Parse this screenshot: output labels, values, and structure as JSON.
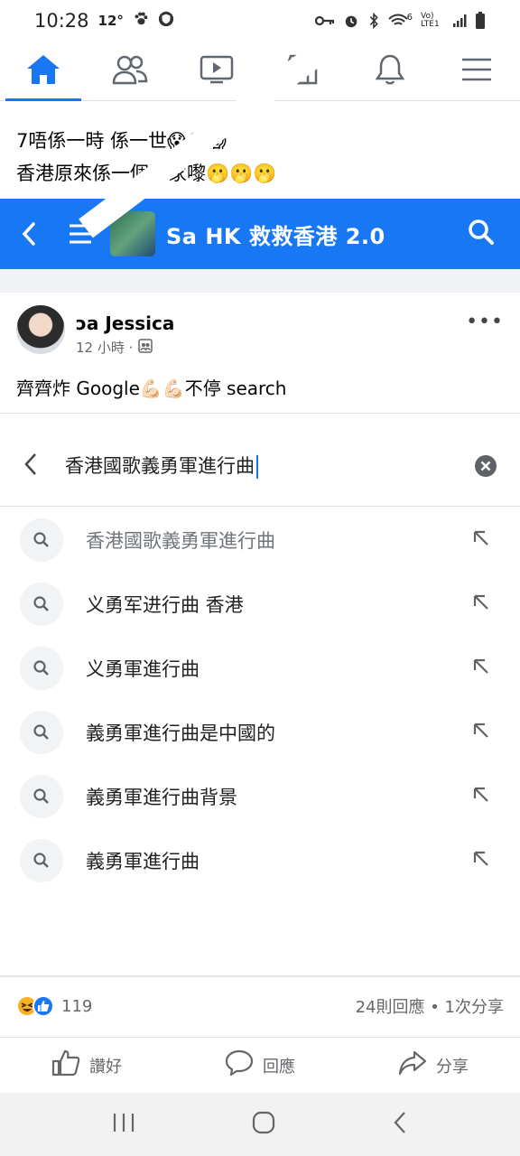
{
  "status_bar": {
    "time": "10:28",
    "temperature": "12°",
    "network_label": "Vo) LTE1",
    "signal_badge": "6",
    "icons": [
      "paw-icon",
      "shield-icon",
      "key-icon",
      "alarm-icon",
      "bluetooth-icon",
      "wifi-icon",
      "signal-icon",
      "battery-icon"
    ]
  },
  "top_nav": {
    "tabs": [
      {
        "name": "home",
        "icon": "home-icon",
        "active": true
      },
      {
        "name": "friends",
        "icon": "friends-icon",
        "active": false
      },
      {
        "name": "watch",
        "icon": "video-icon",
        "active": false
      },
      {
        "name": "marketplace",
        "icon": "store-icon",
        "active": false
      },
      {
        "name": "notifications",
        "icon": "bell-icon",
        "active": false
      },
      {
        "name": "menu",
        "icon": "hamburger-icon",
        "active": false
      }
    ]
  },
  "post": {
    "text_lines": [
      "7唔係一時 係一世😱😱😱",
      "香港原來係一個國家嚟🫢🫢🫢"
    ]
  },
  "shared_group": {
    "name": "Sa   HK 救救香港 2.0"
  },
  "shared_post": {
    "author": "ɔa Jessica",
    "time": "12 小時 ·",
    "body": "齊齊炸 Google💪🏻💪🏻不停 search",
    "search_query": "香港國歌義勇軍進行曲",
    "suggestions": [
      {
        "text": "香港國歌義勇軍進行曲",
        "muted": true
      },
      {
        "text": "义勇军进行曲 香港",
        "muted": false
      },
      {
        "text": "义勇軍進行曲",
        "muted": false
      },
      {
        "text": "義勇軍進行曲是中國的",
        "muted": false
      },
      {
        "text": "義勇軍進行曲背景",
        "muted": false
      },
      {
        "text": "義勇軍進行曲",
        "muted": false
      }
    ]
  },
  "stats": {
    "reaction_count": "119",
    "comments_shares": "24則回應 • 1次分享"
  },
  "actions": {
    "like": "讚好",
    "comment": "回應",
    "share": "分享"
  },
  "colors": {
    "brand_blue": "#1877f2",
    "muted_text": "#65676b"
  }
}
